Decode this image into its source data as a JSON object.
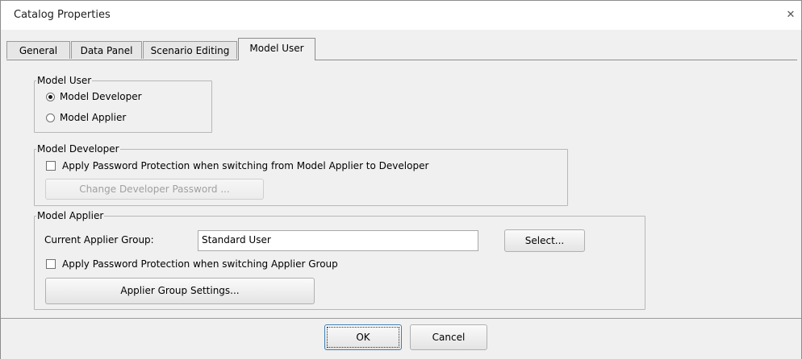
{
  "window": {
    "title": "Catalog Properties",
    "close_glyph": "✕"
  },
  "tabs": [
    {
      "label": "General",
      "active": false
    },
    {
      "label": "Data Panel",
      "active": false
    },
    {
      "label": "Scenario Editing",
      "active": false
    },
    {
      "label": "Model User",
      "active": true
    }
  ],
  "model_user": {
    "legend": "Model User",
    "options": [
      {
        "label": "Model Developer",
        "checked": true
      },
      {
        "label": "Model Applier",
        "checked": false
      }
    ]
  },
  "model_developer": {
    "legend": "Model Developer",
    "checkbox_label": "Apply Password Protection when switching from Model Applier to Developer",
    "checkbox_checked": false,
    "change_password_button": "Change Developer Password ..."
  },
  "model_applier": {
    "legend": "Model Applier",
    "group_label": "Current Applier Group:",
    "group_value": "Standard User",
    "select_button": "Select...",
    "checkbox_label": "Apply Password Protection when switching Applier Group",
    "checkbox_checked": false,
    "settings_button": "Applier Group Settings..."
  },
  "footer": {
    "ok_label": "OK",
    "cancel_label": "Cancel"
  }
}
